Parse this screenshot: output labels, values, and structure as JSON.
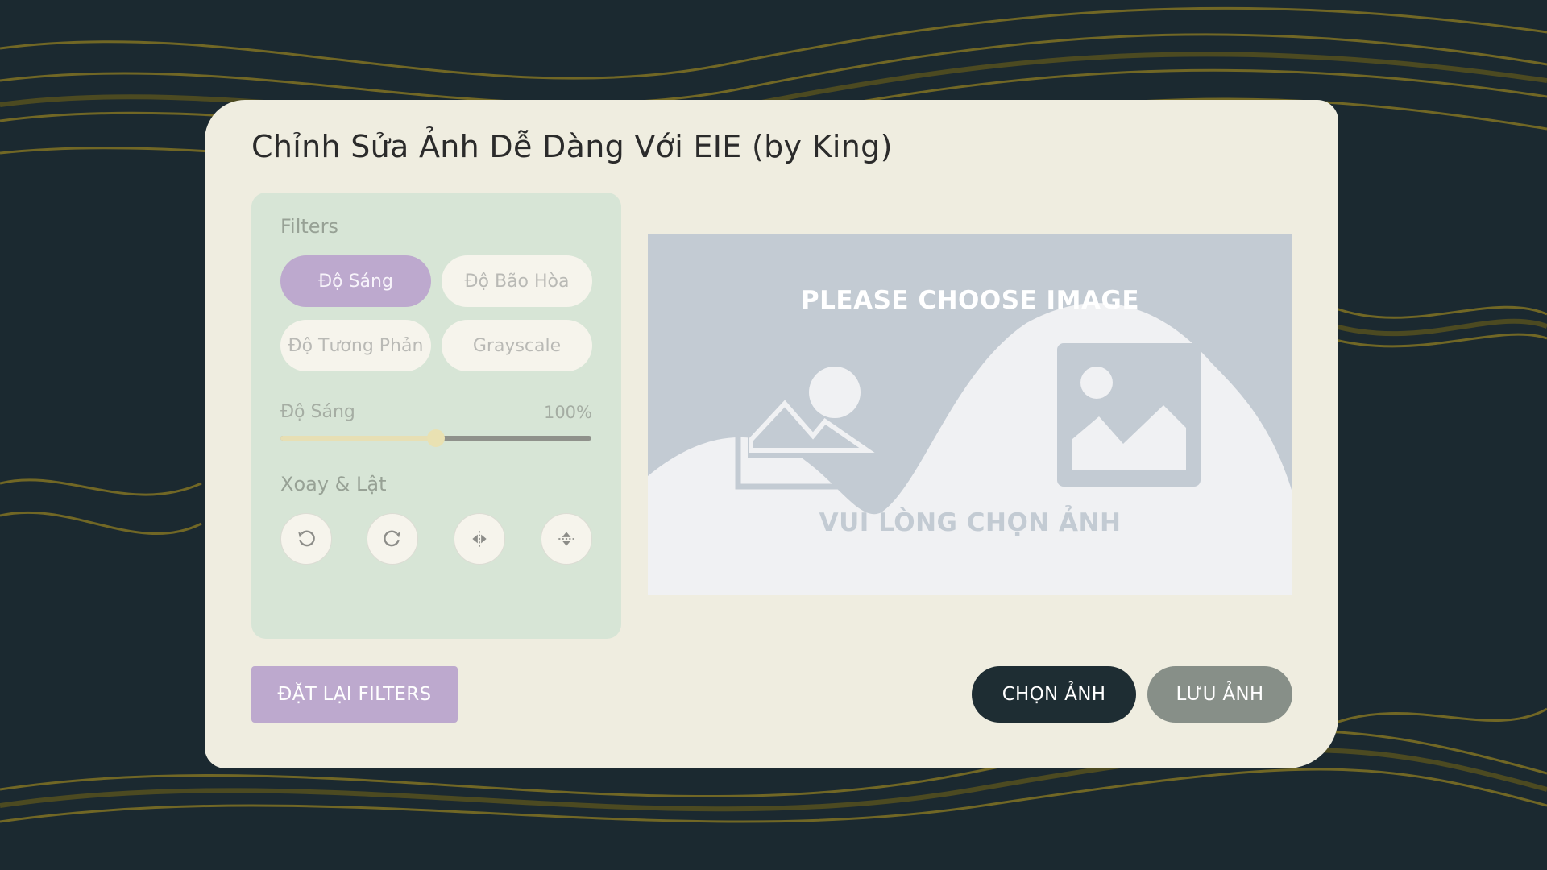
{
  "app": {
    "title": "Chỉnh Sửa Ảnh Dễ Dàng Với EIE (by King)"
  },
  "filters": {
    "section_label": "Filters",
    "options": [
      {
        "label": "Độ Sáng",
        "active": true
      },
      {
        "label": "Độ Bão Hòa",
        "active": false
      },
      {
        "label": "Độ Tương Phản",
        "active": false
      },
      {
        "label": "Grayscale",
        "active": false
      }
    ],
    "slider": {
      "name": "Độ Sáng",
      "value_text": "100%",
      "fraction": 0.5
    }
  },
  "transform": {
    "section_label": "Xoay & Lật",
    "buttons": [
      {
        "icon": "rotate-left-icon"
      },
      {
        "icon": "rotate-right-icon"
      },
      {
        "icon": "flip-horizontal-icon"
      },
      {
        "icon": "flip-vertical-icon"
      }
    ]
  },
  "preview": {
    "heading": "PLEASE CHOOSE IMAGE",
    "subheading": "VUI LÒNG CHỌN ẢNH"
  },
  "actions": {
    "reset_label": "ĐẶT LẠI FILTERS",
    "choose_label": "CHỌN ẢNH",
    "save_label": "LƯU ẢNH"
  },
  "colors": {
    "card": "#efede0",
    "panel": "#d7e5d6",
    "accent": "#bda9ce",
    "dark": "#1e2d33",
    "muted": "#878f88"
  }
}
